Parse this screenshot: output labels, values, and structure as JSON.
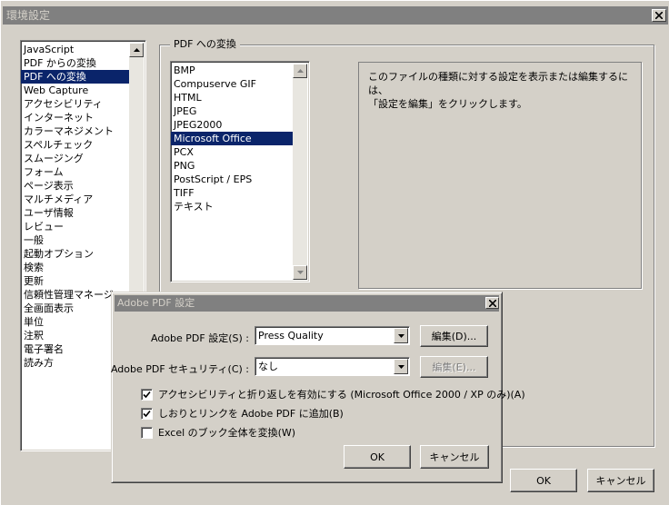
{
  "window": {
    "title": "環境設定",
    "ok_label": "OK",
    "cancel_label": "キャンセル"
  },
  "sidebar": {
    "items": [
      "JavaScript",
      "PDF からの変換",
      "PDF への変換",
      "Web Capture",
      "アクセシビリティ",
      "インターネット",
      "カラーマネジメント",
      "スペルチェック",
      "スムージング",
      "フォーム",
      "ページ表示",
      "マルチメディア",
      "ユーザ情報",
      "レビュー",
      "一般",
      "起動オプション",
      "検索",
      "更新",
      "信頼性管理マネージャ",
      "全画面表示",
      "単位",
      "注釈",
      "電子署名",
      "読み方"
    ],
    "selected_index": 2
  },
  "group": {
    "label": "PDF への変換",
    "formats": [
      "BMP",
      "Compuserve GIF",
      "HTML",
      "JPEG",
      "JPEG2000",
      "Microsoft Office",
      "PCX",
      "PNG",
      "PostScript / EPS",
      "TIFF",
      "テキスト"
    ],
    "selected_index": 5,
    "info_line1": "このファイルの種類に対する設定を表示または編集するには、",
    "info_line2": "「設定を編集」をクリックします。"
  },
  "dialog": {
    "title": "Adobe PDF 設定",
    "settings_label": "Adobe PDF 設定(S) :",
    "settings_value": "Press Quality",
    "edit1_label": "編集(D)...",
    "security_label": "Adobe PDF セキュリティ(C) :",
    "security_value": "なし",
    "edit2_label": "編集(E)...",
    "check1_label": "アクセシビリティと折り返しを有効にする (Microsoft Office 2000 / XP のみ)(A)",
    "check1_checked": true,
    "check2_label": "しおりとリンクを Adobe PDF に追加(B)",
    "check2_checked": true,
    "check3_label": "Excel のブック全体を変換(W)",
    "check3_checked": false,
    "ok_label": "OK",
    "cancel_label": "キャンセル"
  }
}
